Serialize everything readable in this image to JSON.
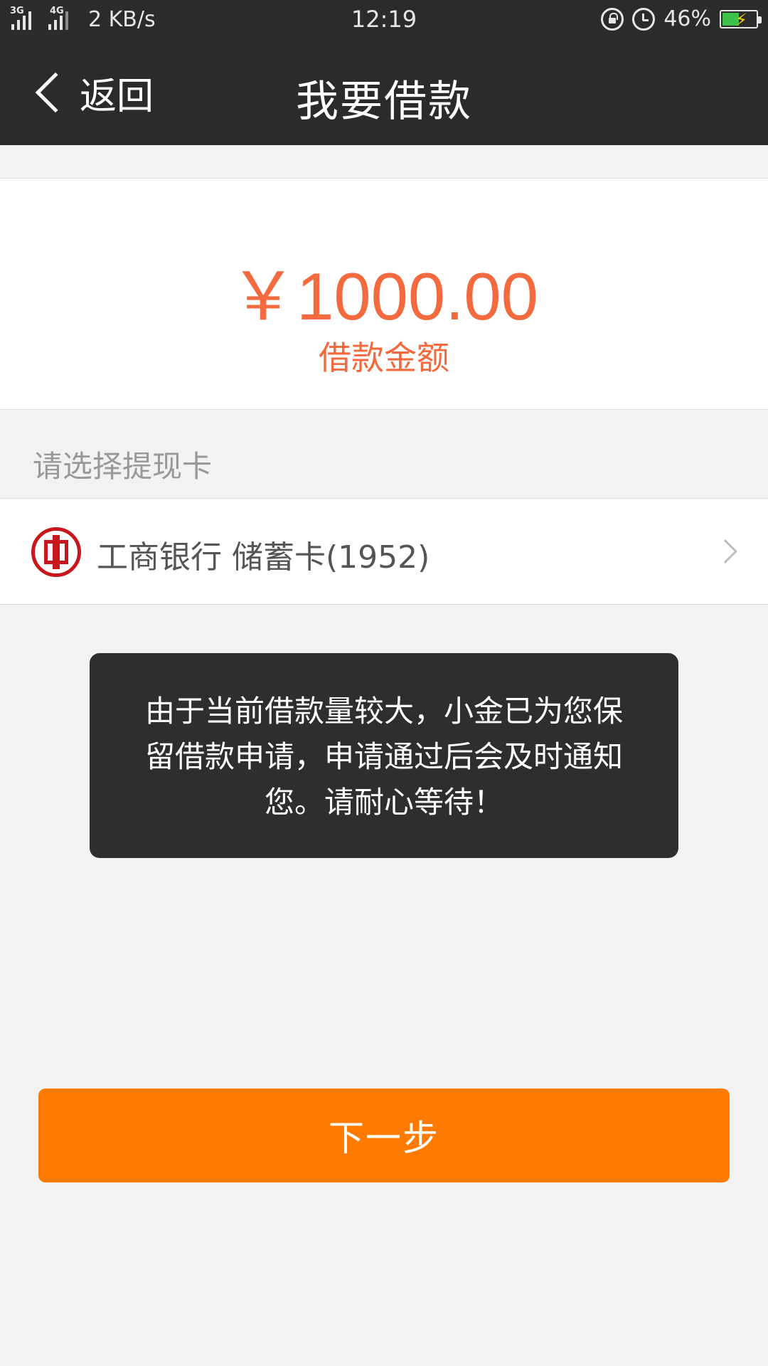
{
  "status_bar": {
    "sim1_label": "3G",
    "sim2_label": "4G",
    "net_speed": "2 KB/s",
    "time": "12:19",
    "battery_pct": "46%",
    "icons": [
      "signal-icon",
      "lock-rotation-icon",
      "alarm-icon",
      "battery-charging-icon"
    ]
  },
  "header": {
    "back_label": "返回",
    "title": "我要借款"
  },
  "amount": {
    "value": "￥1000.00",
    "label": "借款金额"
  },
  "withdraw": {
    "section_label": "请选择提现卡",
    "card_name": "工商银行 储蓄卡(1952)"
  },
  "toast": {
    "message": "由于当前借款量较大，小金已为您保留借款申请，申请通过后会及时通知您。请耐心等待！"
  },
  "footer": {
    "next_label": "下一步"
  },
  "colors": {
    "accent_orange": "#ff7a00",
    "amount_orange": "#f26a3d",
    "dark_bar": "#2b2b2b",
    "toast_bg": "#2e2e2e",
    "bank_red": "#c8161d"
  }
}
